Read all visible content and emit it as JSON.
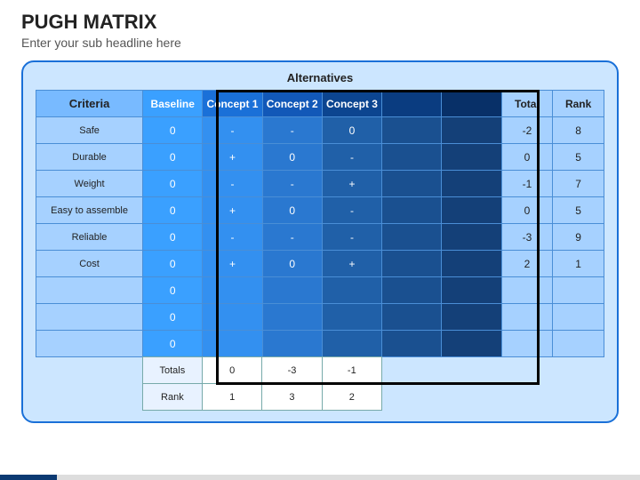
{
  "title": "PUGH MATRIX",
  "subtitle": "Enter your sub headline here",
  "alt_label": "Alternatives",
  "headers": {
    "criteria": "Criteria",
    "baseline": "Baseline",
    "c1": "Concept 1",
    "c2": "Concept 2",
    "c3": "Concept 3",
    "total": "Total",
    "rank": "Rank"
  },
  "rows": [
    {
      "label": "Safe",
      "base": "0",
      "c1": "-",
      "c2": "-",
      "c3": "0",
      "total": "-2",
      "rank": "8"
    },
    {
      "label": "Durable",
      "base": "0",
      "c1": "+",
      "c2": "0",
      "c3": "-",
      "total": "0",
      "rank": "5"
    },
    {
      "label": "Weight",
      "base": "0",
      "c1": "-",
      "c2": "-",
      "c3": "+",
      "total": "-1",
      "rank": "7"
    },
    {
      "label": "Easy to assemble",
      "base": "0",
      "c1": "+",
      "c2": "0",
      "c3": "-",
      "total": "0",
      "rank": "5"
    },
    {
      "label": "Reliable",
      "base": "0",
      "c1": "-",
      "c2": "-",
      "c3": "-",
      "total": "-3",
      "rank": "9"
    },
    {
      "label": "Cost",
      "base": "0",
      "c1": "+",
      "c2": "0",
      "c3": "+",
      "total": "2",
      "rank": "1"
    },
    {
      "label": "",
      "base": "0",
      "c1": "",
      "c2": "",
      "c3": "",
      "total": "",
      "rank": ""
    },
    {
      "label": "",
      "base": "0",
      "c1": "",
      "c2": "",
      "c3": "",
      "total": "",
      "rank": ""
    },
    {
      "label": "",
      "base": "0",
      "c1": "",
      "c2": "",
      "c3": "",
      "total": "",
      "rank": ""
    }
  ],
  "summary": {
    "totals_label": "Totals",
    "rank_label": "Rank",
    "totals": [
      "0",
      "-3",
      "-1"
    ],
    "rank": [
      "1",
      "3",
      "2"
    ]
  }
}
